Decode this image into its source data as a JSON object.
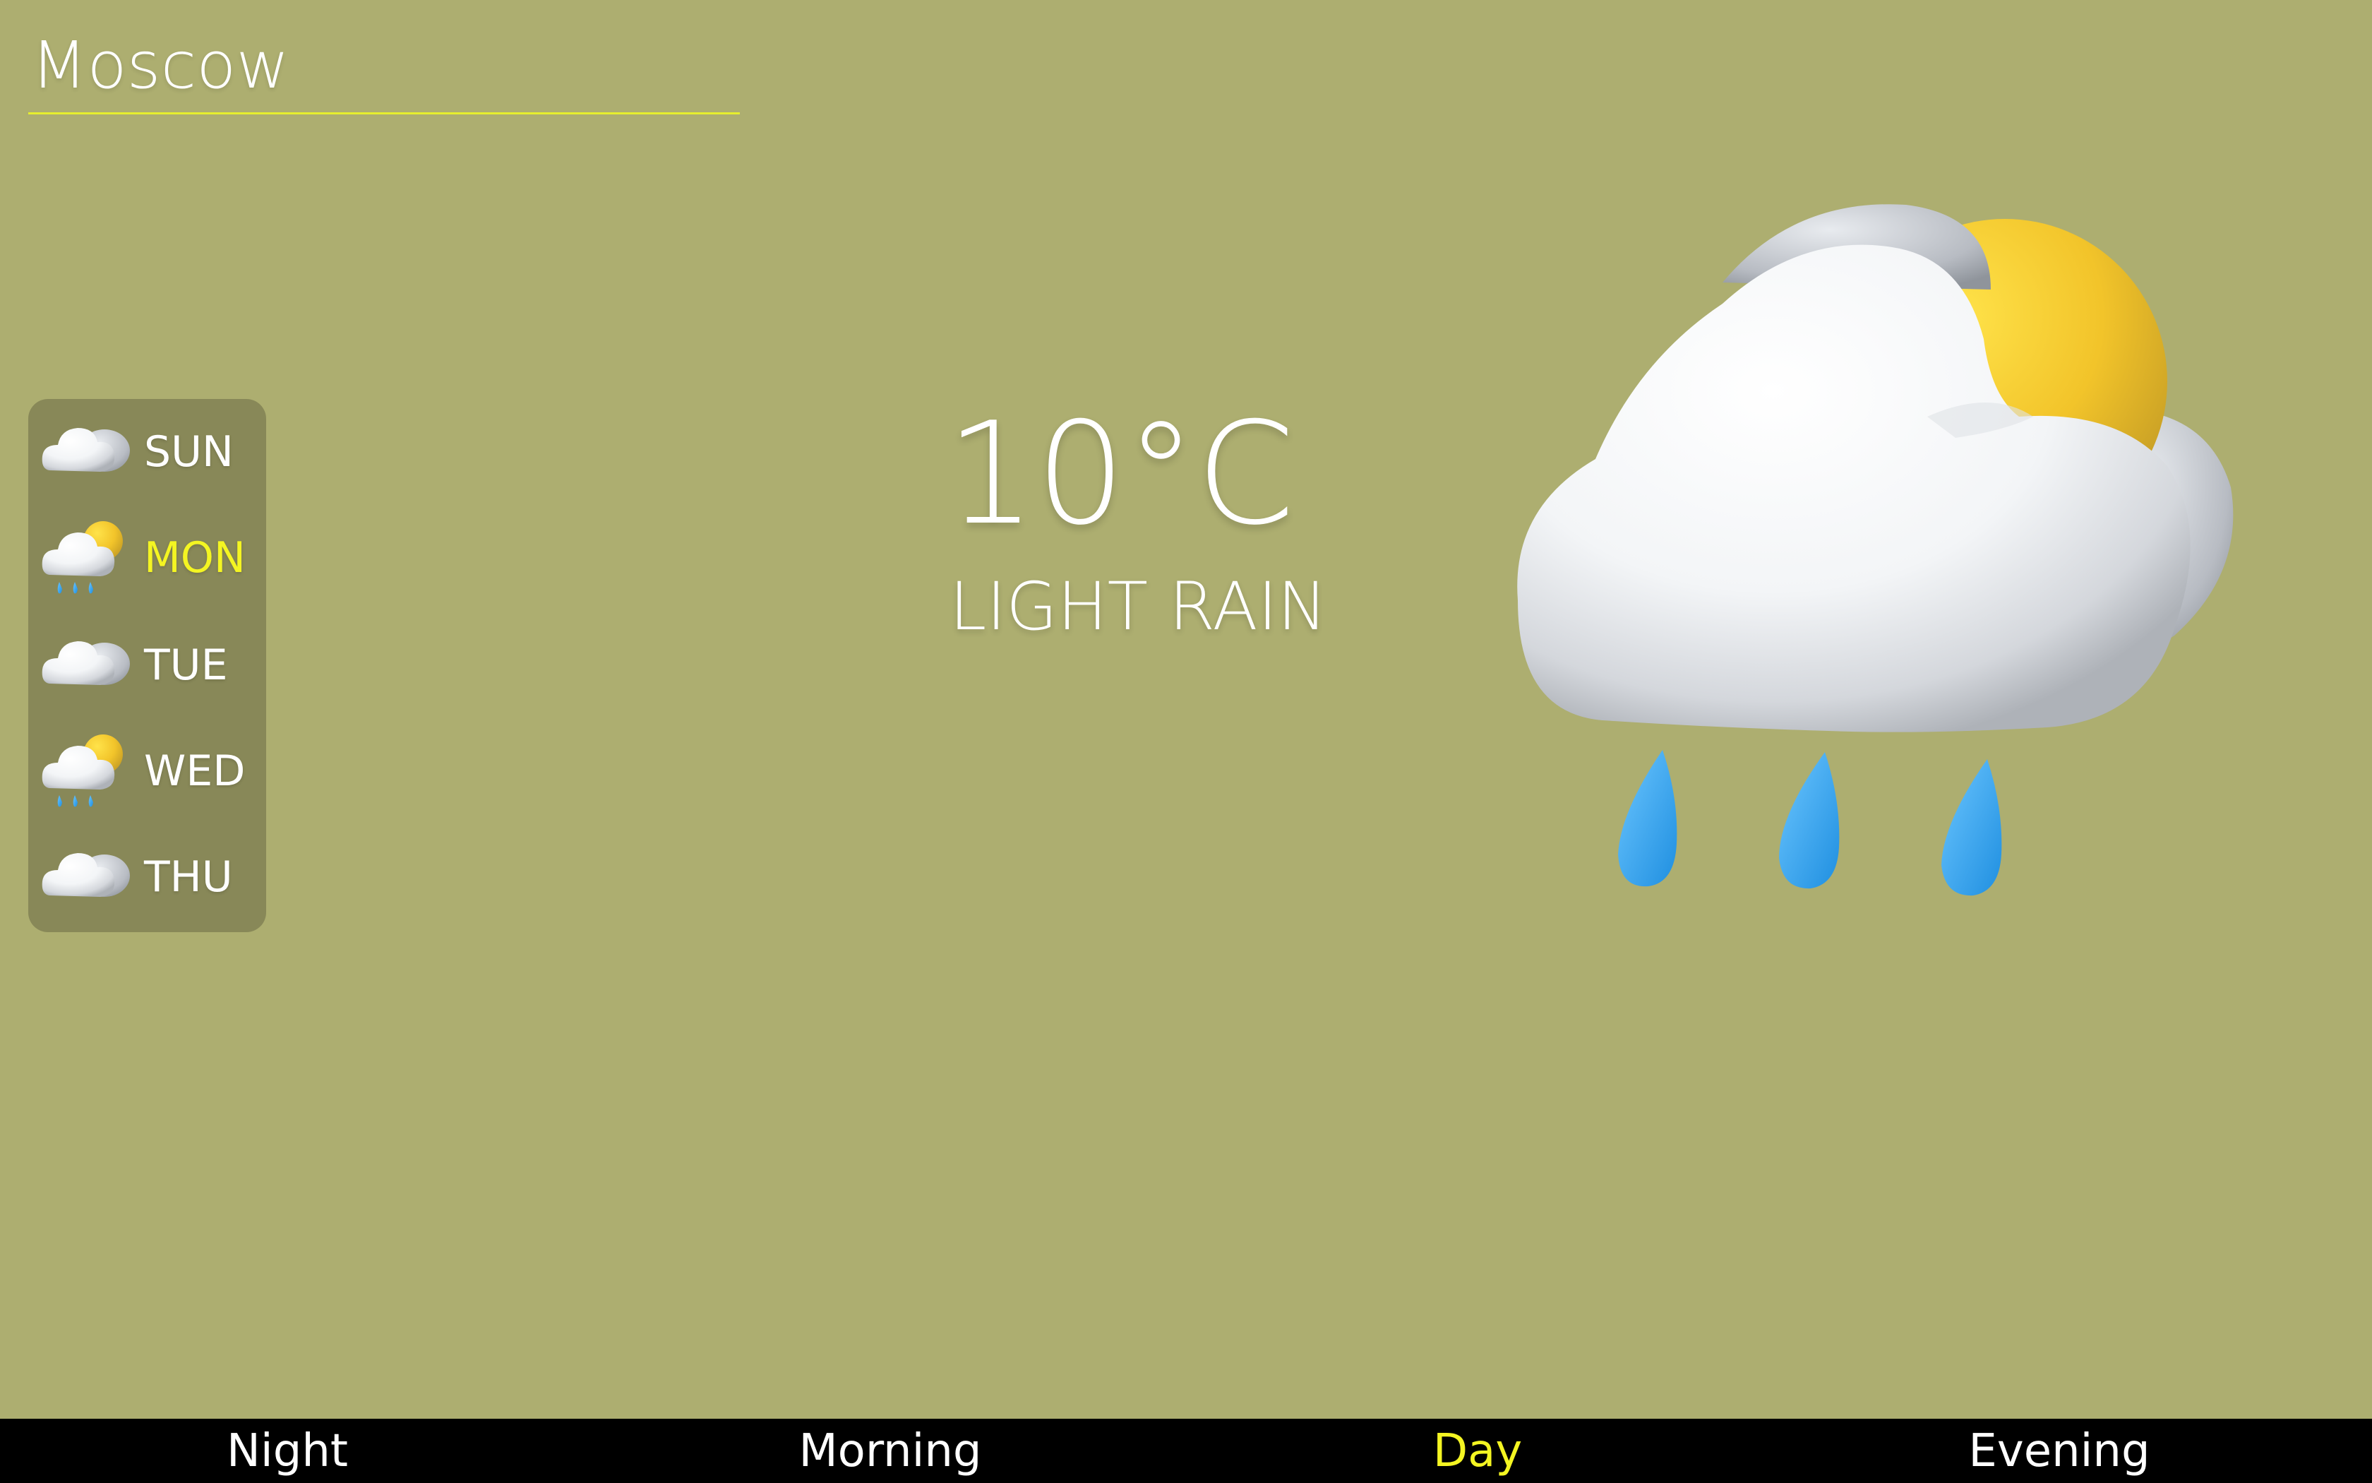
{
  "location": {
    "city": "Moscow"
  },
  "current": {
    "temperature": "10°C",
    "condition": "LIGHT RAIN",
    "icon": "cloud-sun-rain-icon"
  },
  "forecast": [
    {
      "day": "SUN",
      "icon": "cloud-icon",
      "selected": false
    },
    {
      "day": "MON",
      "icon": "cloud-sun-rain-icon",
      "selected": true
    },
    {
      "day": "TUE",
      "icon": "cloud-icon",
      "selected": false
    },
    {
      "day": "WED",
      "icon": "cloud-sun-rain-icon",
      "selected": false
    },
    {
      "day": "THU",
      "icon": "cloud-icon",
      "selected": false
    }
  ],
  "periods": [
    {
      "label": "Night",
      "selected": false
    },
    {
      "label": "Morning",
      "selected": false
    },
    {
      "label": "Day",
      "selected": true
    },
    {
      "label": "Evening",
      "selected": false
    }
  ],
  "colors": {
    "background": "#adae70",
    "accent": "#f4f522",
    "underline": "#e6ee2e",
    "bar": "#000000",
    "text": "#ffffff"
  }
}
